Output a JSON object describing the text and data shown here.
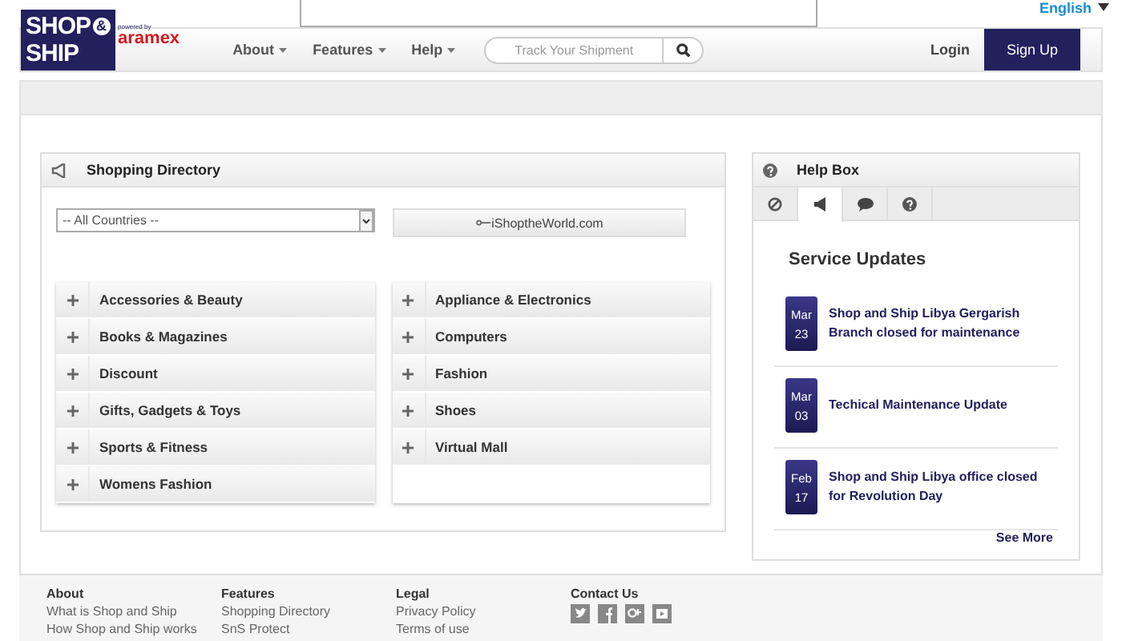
{
  "language": {
    "label": "English"
  },
  "logo": {
    "line_1": "SHOP",
    "ampersand": "&",
    "line_2": "SHIP",
    "powered_by": "powered by",
    "brand": "aramex"
  },
  "nav": {
    "menus": [
      {
        "label": "About"
      },
      {
        "label": "Features"
      },
      {
        "label": "Help"
      }
    ],
    "search": {
      "placeholder": "Track Your Shipment"
    },
    "login": "Login",
    "signup": "Sign Up"
  },
  "directory": {
    "title": "Shopping Directory",
    "country_select": {
      "value": "-- All Countries --"
    },
    "link_button": "iShoptheWorld.com",
    "columns": [
      [
        {
          "label": "Accessories & Beauty",
          "expanded": false
        },
        {
          "label": "Books & Magazines",
          "expanded": false
        },
        {
          "label": "Discount",
          "expanded": false
        },
        {
          "label": "Gifts, Gadgets & Toys",
          "expanded": false
        },
        {
          "label": "Sports & Fitness",
          "expanded": false
        },
        {
          "label": "Womens Fashion",
          "expanded": false
        }
      ],
      [
        {
          "label": "Appliance & Electronics",
          "expanded": false
        },
        {
          "label": "Computers",
          "expanded": false
        },
        {
          "label": "Fashion",
          "expanded": false
        },
        {
          "label": "Shoes",
          "expanded": false
        },
        {
          "label": "Virtual Mall",
          "expanded": false
        }
      ]
    ]
  },
  "help_box": {
    "title": "Help Box",
    "tabs": [
      {
        "selected": false
      },
      {
        "selected": true
      },
      {
        "selected": false
      },
      {
        "selected": false
      }
    ],
    "heading": "Service Updates",
    "updates": [
      {
        "month": "Mar",
        "day": "23",
        "text": "Shop and Ship Libya Gergarish Branch closed for maintenance"
      },
      {
        "month": "Mar",
        "day": "03",
        "text": "Techical Maintenance Update"
      },
      {
        "month": "Feb",
        "day": "17",
        "text": "Shop and Ship Libya office closed for Revolution Day"
      }
    ],
    "see_more": "See More"
  },
  "footer": {
    "columns": [
      {
        "title": "About",
        "links": [
          "What is Shop and Ship",
          "How Shop and Ship works"
        ]
      },
      {
        "title": "Features",
        "links": [
          "Shopping Directory",
          "SnS Protect"
        ]
      },
      {
        "title": "Legal",
        "links": [
          "Privacy Policy",
          "Terms of use"
        ]
      }
    ],
    "contact": {
      "title": "Contact Us"
    }
  }
}
